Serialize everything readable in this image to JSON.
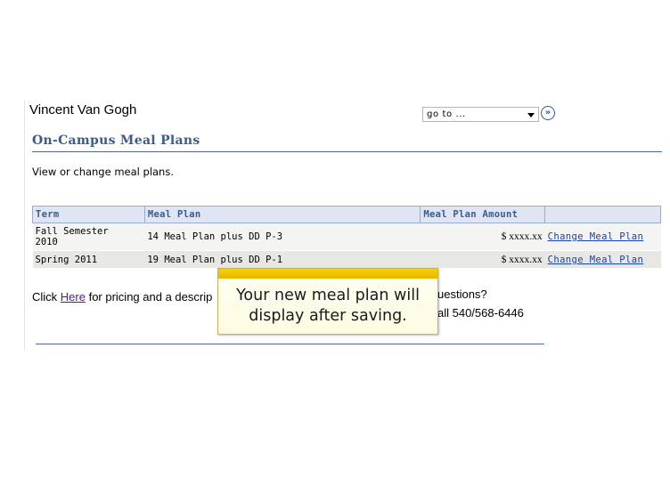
{
  "header": {
    "user_name": "Vincent Van Gogh",
    "goto_select_value": "go to ...",
    "go_button_icon": "double-chevron-right-icon"
  },
  "page": {
    "title": "On-Campus Meal Plans",
    "intro": "View or change meal plans."
  },
  "table": {
    "columns": [
      "Term",
      "Meal Plan",
      "Meal Plan Amount",
      ""
    ],
    "rows": [
      {
        "term_line1": "Fall Semester",
        "term_line2": "2010",
        "plan": "14 Meal Plan plus DD P-3",
        "amount": "$ xxxx.xx",
        "action": "Change Meal Plan"
      },
      {
        "term_line1": "Spring 2011",
        "term_line2": "",
        "plan": "19 Meal Plan plus DD P-1",
        "amount": "$ xxxx.xx",
        "action": "Change Meal Plan"
      }
    ]
  },
  "footer": {
    "pricing_prefix": "Click ",
    "pricing_link": "Here",
    "pricing_suffix": " for pricing and a descrip",
    "questions": "uestions?",
    "phone": "all 540/568-6446"
  },
  "callout": {
    "line1": "Your new meal plan will",
    "line2": "display after saving."
  },
  "colors": {
    "title": "#3c5a8c",
    "link": "#1a3fa8",
    "header_bg": "#dfe5f2",
    "callout_bar": "#f2c500"
  }
}
